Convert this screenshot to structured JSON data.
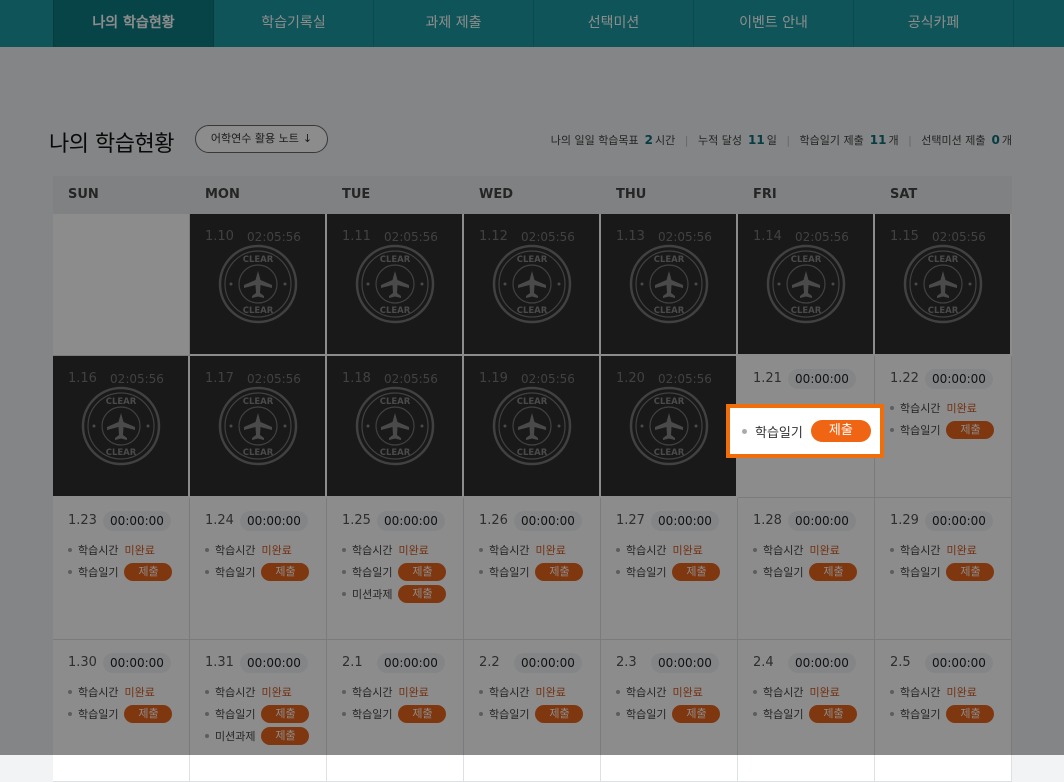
{
  "nav": {
    "tabs": [
      {
        "label": "나의 학습현황",
        "active": true
      },
      {
        "label": "학습기록실",
        "active": false
      },
      {
        "label": "과제 제출",
        "active": false
      },
      {
        "label": "선택미션",
        "active": false
      },
      {
        "label": "이벤트 안내",
        "active": false
      },
      {
        "label": "공식카페",
        "active": false
      }
    ]
  },
  "header": {
    "title": "나의 학습현황",
    "note_button": "어학연수 활용 노트",
    "note_icon": "↓"
  },
  "stats": {
    "daily_goal_label": "나의 일일 학습목표",
    "daily_goal_value": "2",
    "daily_goal_unit": "시간",
    "achieved_label": "누적 달성",
    "achieved_value": "11",
    "achieved_unit": "일",
    "diary_label": "학습일기 제출",
    "diary_value": "11",
    "diary_unit": "개",
    "mission_label": "선택미션 제출",
    "mission_value": "0",
    "mission_unit": "개"
  },
  "calendar": {
    "weekdays": [
      "SUN",
      "MON",
      "TUE",
      "WED",
      "THU",
      "FRI",
      "SAT"
    ],
    "stamp": {
      "top_text": "CLEAR",
      "bottom_text": "CLEAR"
    },
    "labels": {
      "study_time": "학습시간",
      "diary": "학습일기",
      "mission": "미션과제",
      "incomplete": "미완료",
      "submit": "제출"
    },
    "weeks": [
      [
        {
          "date": "",
          "time": ""
        },
        {
          "date": "1.10",
          "time": "02:05:56",
          "clear": true
        },
        {
          "date": "1.11",
          "time": "02:05:56",
          "clear": true
        },
        {
          "date": "1.12",
          "time": "02:05:56",
          "clear": true
        },
        {
          "date": "1.13",
          "time": "02:05:56",
          "clear": true
        },
        {
          "date": "1.14",
          "time": "02:05:56",
          "clear": true
        },
        {
          "date": "1.15",
          "time": "02:05:56",
          "clear": true
        }
      ],
      [
        {
          "date": "1.16",
          "time": "02:05:56",
          "clear": true
        },
        {
          "date": "1.17",
          "time": "02:05:56",
          "clear": true
        },
        {
          "date": "1.18",
          "time": "02:05:56",
          "clear": true
        },
        {
          "date": "1.19",
          "time": "02:05:56",
          "clear": true
        },
        {
          "date": "1.20",
          "time": "02:05:56",
          "clear": true
        },
        {
          "date": "1.21",
          "time": "00:00:00"
        },
        {
          "date": "1.22",
          "time": "00:00:00",
          "items": [
            "time",
            "diary"
          ]
        }
      ],
      [
        {
          "date": "1.23",
          "time": "00:00:00",
          "items": [
            "time",
            "diary"
          ]
        },
        {
          "date": "1.24",
          "time": "00:00:00",
          "items": [
            "time",
            "diary"
          ]
        },
        {
          "date": "1.25",
          "time": "00:00:00",
          "items": [
            "time",
            "diary",
            "mission"
          ]
        },
        {
          "date": "1.26",
          "time": "00:00:00",
          "items": [
            "time",
            "diary"
          ]
        },
        {
          "date": "1.27",
          "time": "00:00:00",
          "items": [
            "time",
            "diary"
          ]
        },
        {
          "date": "1.28",
          "time": "00:00:00",
          "items": [
            "time",
            "diary"
          ]
        },
        {
          "date": "1.29",
          "time": "00:00:00",
          "items": [
            "time",
            "diary"
          ]
        }
      ],
      [
        {
          "date": "1.30",
          "time": "00:00:00",
          "items": [
            "time",
            "diary"
          ]
        },
        {
          "date": "1.31",
          "time": "00:00:00",
          "items": [
            "time",
            "diary",
            "mission"
          ]
        },
        {
          "date": "2.1",
          "time": "00:00:00",
          "items": [
            "time",
            "diary"
          ]
        },
        {
          "date": "2.2",
          "time": "00:00:00",
          "items": [
            "time",
            "diary"
          ]
        },
        {
          "date": "2.3",
          "time": "00:00:00",
          "items": [
            "time",
            "diary"
          ]
        },
        {
          "date": "2.4",
          "time": "00:00:00",
          "items": [
            "time",
            "diary"
          ]
        },
        {
          "date": "2.5",
          "time": "00:00:00",
          "items": [
            "time",
            "diary"
          ]
        }
      ]
    ]
  },
  "spotlight": {
    "label": "학습일기",
    "button": "제출"
  },
  "colors": {
    "nav": "#1d9aa1",
    "nav_active": "#0e7d84",
    "accent": "#e8641d",
    "highlight_border": "#f06d0c"
  }
}
